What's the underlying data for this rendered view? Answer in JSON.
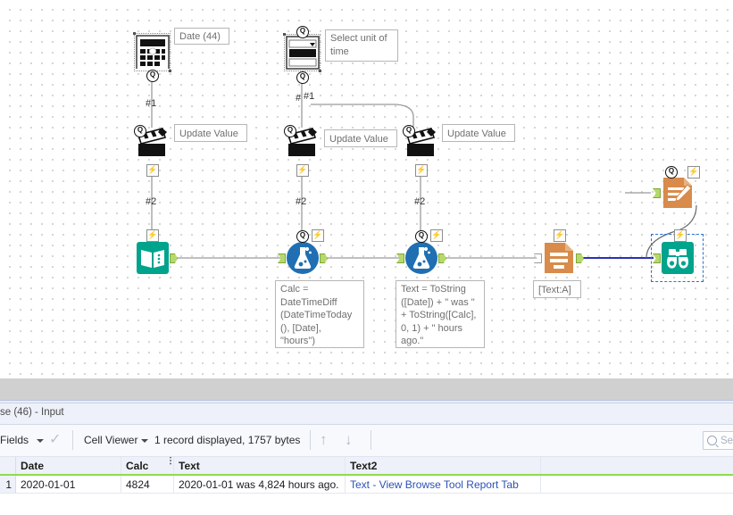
{
  "canvas": {
    "tools": [
      {
        "id": "date-interface",
        "name": "date-tool",
        "label": "Date (44)",
        "icon": "calculator-icon"
      },
      {
        "id": "unit-dropdown",
        "name": "dropdown-tool",
        "label": "Select unit of\ntime",
        "icon": "dropdown-icon"
      },
      {
        "id": "action-1",
        "name": "action-tool-1",
        "label": "Update Value",
        "icon": "clapperboard-icon"
      },
      {
        "id": "action-2",
        "name": "action-tool-2",
        "label": "Update Value",
        "icon": "clapperboard-icon"
      },
      {
        "id": "action-3",
        "name": "action-tool-3",
        "label": "Update Value",
        "icon": "clapperboard-icon"
      },
      {
        "id": "text-input",
        "name": "text-input-tool",
        "label": "",
        "icon": "book-icon"
      },
      {
        "id": "formula-1",
        "name": "formula-tool-1",
        "label": "",
        "icon": "flask-icon"
      },
      {
        "id": "formula-2",
        "name": "formula-tool-2",
        "label": "",
        "icon": "flask-icon"
      },
      {
        "id": "select-tool",
        "name": "select-tool",
        "label": "[Text:A]",
        "icon": "document-lines-icon"
      },
      {
        "id": "report-text",
        "name": "report-text-tool",
        "label": "",
        "icon": "document-pencil-icon"
      },
      {
        "id": "browse",
        "name": "browse-tool",
        "label": "",
        "icon": "binoculars-icon"
      }
    ],
    "annotations": [
      {
        "id": "annot-date",
        "text": "Date (44)"
      },
      {
        "id": "annot-unit",
        "text": "Select unit of\ntime"
      },
      {
        "id": "annot-action1",
        "text": "Update Value"
      },
      {
        "id": "annot-action2",
        "text": "Update Value"
      },
      {
        "id": "annot-action3",
        "text": "Update Value"
      },
      {
        "id": "annot-formula1",
        "text": "Calc =\nDateTimeDiff\n(DateTimeToday\n(), [Date],\n\"hours\")"
      },
      {
        "id": "annot-formula2",
        "text": "Text = ToString\n([Date]) + \" was \"\n+ ToString([Calc],\n0, 1) + \" hours\nago.\""
      },
      {
        "id": "annot-select",
        "text": "[Text:A]"
      }
    ],
    "connection_labels": [
      {
        "id": "conn-1a",
        "text": "#1"
      },
      {
        "id": "conn-1b",
        "text": "#1"
      },
      {
        "id": "conn-1c",
        "text": "#"
      },
      {
        "id": "conn-2a",
        "text": "#2"
      },
      {
        "id": "conn-2b",
        "text": "#2"
      },
      {
        "id": "conn-2c",
        "text": "#2"
      }
    ],
    "colors": {
      "teal": "#00a38c",
      "blue": "#1f6fb2",
      "orange": "#d88b4a",
      "anchor_green": "#b5d96a",
      "wire_grey": "#9b9b9b",
      "wire_blue": "#2b30b8",
      "selection_blue": "#2b6fd1"
    }
  },
  "bottom_panel": {
    "tab_label": "se (46) - Input",
    "toolbar": {
      "fields_label": "Fields",
      "check_icon": "check-icon",
      "cell_viewer_label": "Cell Viewer",
      "record_status": "1 record displayed, 1757 bytes",
      "up_arrow_icon": "arrow-up-icon",
      "down_arrow_icon": "arrow-down-icon",
      "search_placeholder": "Se",
      "search_icon": "search-icon"
    },
    "grid": {
      "columns": [
        "",
        "Date",
        "Calc",
        "Text",
        "Text2"
      ],
      "rows": [
        {
          "num": "1",
          "Date": "2020-01-01",
          "Calc": "4824",
          "Text": "2020-01-01 was 4,824 hours ago.",
          "Text2": "Text - View Browse Tool Report Tab"
        }
      ]
    }
  }
}
